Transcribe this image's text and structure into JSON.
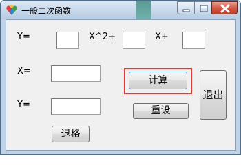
{
  "window": {
    "title": "一般二次函数",
    "controls": {
      "minimize_icon": "minimize-icon",
      "maximize_icon": "maximize-icon",
      "close_icon": "close-icon"
    }
  },
  "form": {
    "row1": {
      "y_label": "Y=",
      "x2_label": "X^2+",
      "x_label": "X+"
    },
    "x_input_label": "X=",
    "y_output_label": "Y=",
    "fields": {
      "coef_a": "",
      "coef_b": "",
      "coef_c": "",
      "x_value": "",
      "y_result": ""
    }
  },
  "buttons": {
    "calculate": "计算",
    "reset": "重设",
    "exit": "退出",
    "backspace": "退格"
  },
  "colors": {
    "highlight": "#e53935",
    "title_bar": "#c6d8eb",
    "close_button": "#d25b45"
  }
}
